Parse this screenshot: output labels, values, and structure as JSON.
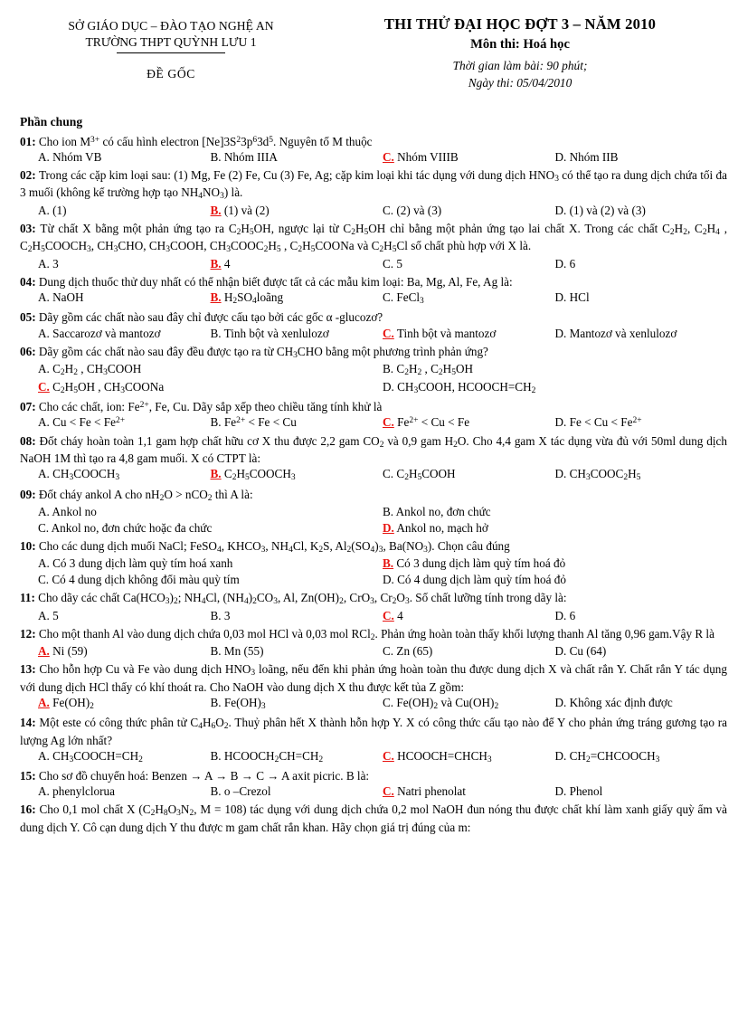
{
  "header": {
    "dept_line1": "SỞ GIÁO DỤC – ĐÀO TẠO NGHỆ AN",
    "dept_line2": "TRƯỜNG THPT QUỲNH LƯU 1",
    "exam_code": "ĐỀ GỐC",
    "title": "THI THỬ ĐẠI HỌC ĐỢT  3 – NĂM 2010",
    "subject": "Môn thi:  Hoá học",
    "duration": "Thời gian làm bài: 90 phút;",
    "exam_date": "Ngày thi: 05/04/2010"
  },
  "section_title": "Phần chung",
  "questions": [
    {
      "number": "01:",
      "stem": "Cho ion M3+ có cấu hình electron [Ne]3S23p63d5. Nguyên tố M thuộc",
      "stem_html": "Cho ion M<sup>3+</sup> có cấu hình  electron [Ne]3S<sup>2</sup>3p<sup>6</sup>3d<sup>5</sup>. Nguyên  tố M thuộc",
      "layout": "four",
      "options": [
        {
          "label": "A.",
          "text": "Nhóm VB",
          "correct": false
        },
        {
          "label": "B.",
          "text": "Nhóm IIIA",
          "correct": false
        },
        {
          "label": "C.",
          "text": "Nhóm VIIIB",
          "correct": true
        },
        {
          "label": "D.",
          "text": "Nhóm IIB",
          "correct": false
        }
      ]
    },
    {
      "number": "02:",
      "stem": "Trong các cặp kim loại sau: (1) Mg, Fe (2) Fe, Cu  (3) Fe, Ag; cặp kim loại khi tác dụng với dung dịch HNO3 có thể tạo ra dung dịch chứa tối đa 3 muối (không kể trường hợp tạo NH4NO3) là.",
      "stem_html": "Trong  các cặp kim loại sau:  (1) Mg, Fe  (2) Fe,  Cu   (3) Fe, Ag; cặp kim loại khi tác dụng với  dung dịch HNO<sub>3</sub> có thể tạo ra dung dịch chứa tối đa 3 muối  (không kể trường hợp tạo NH<sub>4</sub>NO<sub>3</sub>) là.",
      "layout": "four",
      "options": [
        {
          "label": "A.",
          "text": "(1)",
          "correct": false
        },
        {
          "label": "B.",
          "text": "(1) và (2)",
          "correct": true
        },
        {
          "label": "C.",
          "text": "(2) và (3)",
          "correct": false
        },
        {
          "label": "D.",
          "text": "(1) và (2) và (3)",
          "correct": false
        }
      ]
    },
    {
      "number": "03:",
      "stem": "Từ chất X bằng một phản ứng tạo ra C2H5OH, ngược lại từ C2H5OH chỉ bằng một phản ứng tạo lai chất X. Trong các chất C2H2, C2H4 , C2H5COOCH3, CH3CHO, CH3COOH, CH3COOC2H5 , C2H5COONa và C2H5Cl số chất phù hợp với X là.",
      "stem_html": "Từ chất X bằng một phản ứng tạo ra C<sub>2</sub>H<sub>5</sub>OH, ngược lại từ C<sub>2</sub>H<sub>5</sub>OH chỉ bằng một phản ứng tạo lai chất X. Trong các chất C<sub>2</sub>H<sub>2</sub>, C<sub>2</sub>H<sub>4</sub> , C<sub>2</sub>H<sub>5</sub>COOCH<sub>3</sub>, CH<sub>3</sub>CHO,  CH<sub>3</sub>COOH, CH<sub>3</sub>COOC<sub>2</sub>H<sub>5</sub> , C<sub>2</sub>H<sub>5</sub>COONa và  C<sub>2</sub>H<sub>5</sub>Cl số chất phù hợp với X là.",
      "layout": "four",
      "options": [
        {
          "label": "A.",
          "text": "3",
          "correct": false
        },
        {
          "label": "B.",
          "text": "4",
          "correct": true
        },
        {
          "label": "C.",
          "text": "5",
          "correct": false
        },
        {
          "label": "D.",
          "text": "6",
          "correct": false
        }
      ]
    },
    {
      "number": "04:",
      "stem": "Dung dịch thuốc thử duy nhất có thể nhận biết được tất cả các mẫu kim loại: Ba, Mg, Al, Fe, Ag là:",
      "stem_html": "Dung  dịch  thuốc  thử  duy nhất  có thể nhận  biết  được tất cả các mẫu kim  loại:  Ba, Mg, Al, Fe, Ag là:",
      "layout": "four",
      "options": [
        {
          "label": "A.",
          "text": "NaOH",
          "correct": false
        },
        {
          "label": "B.",
          "text": "H2SO4loãng",
          "correct": true,
          "html": "H<sub>2</sub>SO<sub>4</sub>loãng"
        },
        {
          "label": "C.",
          "text": "FeCl3",
          "correct": false,
          "html": "FeCl<sub>3</sub>"
        },
        {
          "label": "D.",
          "text": "HCl",
          "correct": false
        }
      ]
    },
    {
      "number": "05:",
      "stem": "Dãy gồm các chất nào sau đây chỉ được cấu tạo bởi các gốc α -glucozơ?",
      "stem_html": "Dãy gồm  các chất nào sau đây chỉ được cấu tạo bởi các gốc &#945; -glucozơ?",
      "layout": "four",
      "options": [
        {
          "label": "A.",
          "text": "Saccarozơ và mantozơ",
          "correct": false
        },
        {
          "label": "B.",
          "text": "Tinh bột và xenlulozơ",
          "correct": false
        },
        {
          "label": "C.",
          "text": "Tinh bột và mantozơ",
          "correct": true
        },
        {
          "label": "D.",
          "text": "Mantozơ và xenlulozơ",
          "correct": false
        }
      ]
    },
    {
      "number": "06:",
      "stem": "Dãy gồm các chất nào sau đây đều được tạo ra từ CH3CHO bằng một phương trình phản ứng?",
      "stem_html": "Dãy gồm  các chất nào sau đây đều được tạo ra từ CH<sub>3</sub>CHO bằng một phương trình phản ứng?",
      "layout": "two",
      "options": [
        {
          "label": "A.",
          "text": "C2H2 , CH3COOH",
          "correct": false,
          "html": "C<sub>2</sub>H<sub>2</sub> , CH<sub>3</sub>COOH"
        },
        {
          "label": "B.",
          "text": "C2H2 , C2H5OH",
          "correct": false,
          "html": "C<sub>2</sub>H<sub>2</sub> , C<sub>2</sub>H<sub>5</sub>OH"
        },
        {
          "label": "C.",
          "text": "C2H5OH , CH3COONa",
          "correct": true,
          "html": "C<sub>2</sub>H<sub>5</sub>OH , CH<sub>3</sub>COONa"
        },
        {
          "label": "D.",
          "text": "CH3COOH, HCOOCH=CH2",
          "correct": false,
          "html": "CH<sub>3</sub>COOH, HCOOCH&#61;CH<sub>2</sub>"
        }
      ]
    },
    {
      "number": "07:",
      "stem": "Cho các chất, ion: Fe2+, Fe, Cu. Dãy sắp xếp theo chiều tăng tính khử là",
      "stem_html": "Cho các chất, ion:  Fe<sup>2+</sup>, Fe, Cu. Dãy sắp xếp theo chiều tăng tính khử là",
      "layout": "four",
      "options": [
        {
          "label": "A.",
          "text": "Cu < Fe < Fe2+",
          "correct": false,
          "html": "Cu &lt; Fe &lt; Fe<sup>2+</sup>"
        },
        {
          "label": "B.",
          "text": "Fe2+ < Fe < Cu",
          "correct": false,
          "html": "Fe<sup>2+</sup> &lt; Fe &lt; Cu"
        },
        {
          "label": "C.",
          "text": "Fe2+ < Cu < Fe",
          "correct": true,
          "html": "Fe<sup>2+</sup> &lt; Cu &lt; Fe"
        },
        {
          "label": "D.",
          "text": "Fe < Cu < Fe2+",
          "correct": false,
          "html": "Fe &lt; Cu &lt; Fe<sup>2+</sup>"
        }
      ]
    },
    {
      "number": "08:",
      "stem": "Đốt cháy hoàn toàn 1,1 gam hợp chất hữu cơ X thu được 2,2 gam CO2 và 0,9 gam H2O. Cho 4,4 gam X tác dụng vừa đủ với 50ml dung dịch NaOH 1M thì tạo ra 4,8 gam muối. X có CTPT là:",
      "stem_html": "Đốt cháy hoàn toàn  1,1 gam hợp chất hữu cơ X thu  được 2,2 gam CO<sub>2</sub> và 0,9 gam  H<sub>2</sub>O. Cho 4,4 gam  X tác dụng vừa đủ với 50ml dung  dịch NaOH 1M thì tạo ra 4,8 gam muối.  X có CTPT là:",
      "layout": "four",
      "options": [
        {
          "label": "A.",
          "text": "CH3COOCH3",
          "correct": false,
          "html": "CH<sub>3</sub>COOCH<sub>3</sub>"
        },
        {
          "label": "B.",
          "text": "C2H5COOCH3",
          "correct": true,
          "html": "C<sub>2</sub>H<sub>5</sub>COOCH<sub>3</sub>"
        },
        {
          "label": "C.",
          "text": "C2H5COOH",
          "correct": false,
          "html": "C<sub>2</sub>H<sub>5</sub>COOH"
        },
        {
          "label": "D.",
          "text": "CH3COOC2H5",
          "correct": false,
          "html": "CH<sub>3</sub>COOC<sub>2</sub>H<sub>5</sub>"
        }
      ]
    },
    {
      "number": "09:",
      "stem": "Đốt cháy ankol A cho nH2O > nCO2 thì A là:",
      "stem_html": "Đốt cháy ankol  A cho nH<sub>2</sub>O &gt; nCO<sub>2</sub> thì  A là:",
      "layout": "two",
      "options": [
        {
          "label": "A.",
          "text": "Ankol no",
          "correct": false
        },
        {
          "label": "B.",
          "text": "Ankol no, đơn chức",
          "correct": false
        },
        {
          "label": "C.",
          "text": "Ankol no, đơn chức hoặc đa chức",
          "correct": false
        },
        {
          "label": "D.",
          "text": "Ankol no, mạch hở",
          "correct": true
        }
      ]
    },
    {
      "number": "10:",
      "stem": "Cho các dung dịch muối NaCl; FeSO4, KHCO3, NH4Cl, K2S, Al2(SO4)3, Ba(NO3). Chọn câu đúng",
      "stem_html": "Cho các dung dịch muối NaCl; FeSO<sub>4</sub>, KHCO<sub>3</sub>, NH<sub>4</sub>Cl, K<sub>2</sub>S, Al<sub>2</sub>(SO<sub>4</sub>)<sub>3</sub>, Ba(NO<sub>3</sub>). Chọn câu đúng",
      "layout": "two",
      "options": [
        {
          "label": "A.",
          "text": "Có 3 dung dịch làm quỳ tím hoá xanh",
          "correct": false
        },
        {
          "label": "B.",
          "text": "Có 3 dung dịch làm quỳ tím hoá đỏ",
          "correct": true
        },
        {
          "label": "C.",
          "text": "Có 4 dung dịch không đổi màu quỳ tím",
          "correct": false
        },
        {
          "label": "D.",
          "text": "Có 4 dung dịch làm quỳ tím hoá đỏ",
          "correct": false
        }
      ]
    },
    {
      "number": "11:",
      "stem": "Cho dãy các chất Ca(HCO3)2; NH4Cl, (NH4)2CO3, Al, Zn(OH)2, CrO3, Cr2O3. Số chất lưỡng tính trong dãy là:",
      "stem_html": "Cho dãy các chất Ca(HCO<sub>3</sub>)<sub>2</sub>; NH<sub>4</sub>Cl, (NH<sub>4</sub>)<sub>2</sub>CO<sub>3</sub>,  Al, Zn(OH)<sub>2</sub>, CrO<sub>3</sub>, Cr<sub>2</sub>O<sub>3</sub>. Số chất lưỡng tính  trong dãy là:",
      "layout": "four",
      "options": [
        {
          "label": "A.",
          "text": "5",
          "correct": false
        },
        {
          "label": "B.",
          "text": "3",
          "correct": false
        },
        {
          "label": "C.",
          "text": "4",
          "correct": true
        },
        {
          "label": "D.",
          "text": "6",
          "correct": false
        }
      ]
    },
    {
      "number": "12:",
      "stem": "Cho một thanh Al vào dung dịch chứa 0,03 mol HCl và 0,03 mol RCl2. Phản ứng hoàn toàn thấy khối lượng thanh Al tăng 0,96 gam.Vậy R là",
      "stem_html": "Cho một thanh  Al vào dung  dịch chứa 0,03 mol HCl và 0,03 mol RCl<sub>2</sub>. Phản ứng hoàn toàn thấy khối lượng thanh Al tăng  0,96 gam.Vậy  R là",
      "layout": "four",
      "options": [
        {
          "label": "A.",
          "text": "Ni (59)",
          "correct": true
        },
        {
          "label": "B.",
          "text": "Mn (55)",
          "correct": false
        },
        {
          "label": "C.",
          "text": "Zn (65)",
          "correct": false
        },
        {
          "label": "D.",
          "text": "Cu (64)",
          "correct": false
        }
      ]
    },
    {
      "number": "13:",
      "stem": "Cho hỗn hợp Cu và Fe vào dung dịch HNO3 loãng, nếu đến khi phản ứng hoàn toàn thu được dung dịch X và chất rắn Y. Chất rắn Y tác dụng với dung dịch HCl thấy có khí thoát ra. Cho NaOH vào dung dịch X thu được kết tủa Z gồm:",
      "stem_html": "Cho hỗn hợp Cu và Fe vào dung  dịch HNO<sub>3</sub> loãng,  nếu đến khi phản ứng hoàn toàn thu  được dung  dịch X và chất rắn Y. Chất rắn Y tác dụng  với  dung  dịch HCl thấy có khí thoát ra. Cho NaOH vào dung  dịch X thu  được kết tủa Z gồm:",
      "layout": "w4a",
      "options": [
        {
          "label": "A.",
          "text": "Fe(OH)2",
          "correct": true,
          "html": "Fe(OH)<sub>2</sub>"
        },
        {
          "label": "B.",
          "text": "Fe(OH)3",
          "correct": false,
          "html": "Fe(OH)<sub>3</sub>"
        },
        {
          "label": "C.",
          "text": "Fe(OH)2 và Cu(OH)2",
          "correct": false,
          "html": "Fe(OH)<sub>2</sub> và  Cu(OH)<sub>2</sub>"
        },
        {
          "label": "D.",
          "text": "Không xác định được",
          "correct": false
        }
      ]
    },
    {
      "number": "14:",
      "stem": "Một este có công thức phân tử C4H6O2. Thuỷ phân hết X thành hỗn hợp Y. X có công thức cấu tạo nào để Y cho phản ứng tráng gương tạo ra lượng Ag lớn nhất?",
      "stem_html": "Một este có công thức phân tử C<sub>4</sub>H<sub>6</sub>O<sub>2</sub>. Thuỷ phân hết X thành hỗn hợp Y. X có công thức cấu tạo nào để Y cho phản ứng tráng gương tạo ra lượng Ag lớn nhất?",
      "layout": "w4a",
      "options": [
        {
          "label": "A.",
          "text": "CH3COOCH=CH2",
          "correct": false,
          "html": "CH<sub>3</sub>COOCH&#61;CH<sub>2</sub>"
        },
        {
          "label": "B.",
          "text": "HCOOCH2CH=CH2",
          "correct": false,
          "html": "HCOOCH<sub>2</sub>CH&#61;CH<sub>2</sub>"
        },
        {
          "label": "C.",
          "text": "HCOOCH=CHCH3",
          "correct": true,
          "html": "HCOOCH&#61;CHCH<sub>3</sub>"
        },
        {
          "label": "D.",
          "text": "CH2=CHCOOCH3",
          "correct": false,
          "html": "CH<sub>2</sub>&#61;CHCOOCH<sub>3</sub>"
        }
      ]
    },
    {
      "number": "15:",
      "stem": "Cho sơ đồ chuyển hoá: Benzen → A → B → C → A axit picric. B là:",
      "stem_html": "Cho sơ đồ chuyển hoá: Benzen  &#8594; A &#8594; B &#8594; C &#8594; A axit  picric.  B là:",
      "layout": "four",
      "options": [
        {
          "label": "A.",
          "text": "phenylclorua",
          "correct": false
        },
        {
          "label": "B.",
          "text": "o –Crezol",
          "correct": false
        },
        {
          "label": "C.",
          "text": "Natri phenolat",
          "correct": true
        },
        {
          "label": "D.",
          "text": "Phenol",
          "correct": false
        }
      ]
    },
    {
      "number": "16:",
      "stem": "Cho 0,1 mol chất X (C2H8O3N2, M = 108) tác dụng với dung dịch chứa 0,2 mol NaOH đun nóng thu được chất khí làm xanh giấy quỳ ẩm và dung dịch Y. Cô cạn dung dịch Y thu được m gam chất rắn khan. Hãy chọn giá trị đúng của m:",
      "stem_html": "Cho 0,1 mol chất X (C<sub>2</sub>H<sub>8</sub>O<sub>3</sub>N<sub>2</sub>, M &#61; 108) tác dụng với dung dịch chứa 0,2 mol  NaOH đun nóng thu  được chất khí làm  xanh  giấy  quỳ  ẩm và dung  dịch Y. Cô cạn dung dịch Y thu  được m gam  chất rắn khan. Hãy chọn  giá trị  đúng của m:",
      "layout": "none",
      "options": []
    }
  ],
  "colors": {
    "correct_answer": "#e8130f",
    "text": "#000000",
    "page_background": "#ffffff"
  }
}
